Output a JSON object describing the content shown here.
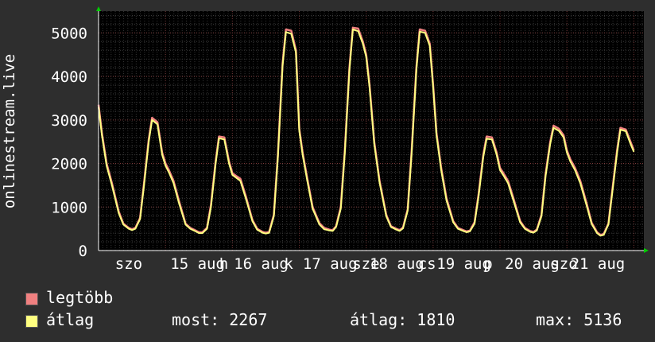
{
  "chart_data": {
    "type": "line",
    "ylabel": "onlinestream.live",
    "ylim": [
      0,
      5500
    ],
    "yticks": [
      0,
      1000,
      2000,
      3000,
      4000,
      5000
    ],
    "x_tick_labels": [
      "szo",
      "15 aug",
      "h",
      "16 aug",
      "k",
      "17 aug",
      "sze",
      "18 aug",
      "cs",
      "19 aug",
      "p",
      "20 aug",
      "szo",
      "21 aug"
    ],
    "grid": true,
    "background": "#000000",
    "series": [
      {
        "name": "legtöbb",
        "color": "#f08080",
        "x": [
          0.0,
          0.05,
          0.12,
          0.2,
          0.3,
          0.37,
          0.45,
          0.5,
          0.55,
          0.62,
          0.68,
          0.75,
          0.8,
          0.88,
          0.95,
          1.0,
          1.05,
          1.12,
          1.2,
          1.3,
          1.37,
          1.45,
          1.5,
          1.55,
          1.62,
          1.68,
          1.75,
          1.8,
          1.88,
          1.95,
          2.0,
          2.05,
          2.12,
          2.2,
          2.3,
          2.37,
          2.45,
          2.5,
          2.55,
          2.62,
          2.68,
          2.75,
          2.8,
          2.88,
          2.95,
          3.0,
          3.05,
          3.12,
          3.2,
          3.3,
          3.37,
          3.45,
          3.5,
          3.55,
          3.62,
          3.68,
          3.75,
          3.8,
          3.88,
          3.95,
          4.0,
          4.05,
          4.12,
          4.2,
          4.3,
          4.37,
          4.45,
          4.5,
          4.55,
          4.62,
          4.68,
          4.75,
          4.8,
          4.88,
          4.95,
          5.0,
          5.05,
          5.12,
          5.2,
          5.3,
          5.37,
          5.45,
          5.5,
          5.55,
          5.62,
          5.68,
          5.75,
          5.8,
          5.88,
          5.95,
          6.0,
          6.05,
          6.12,
          6.2,
          6.3,
          6.37,
          6.45,
          6.5,
          6.55,
          6.62,
          6.68,
          6.75,
          6.8,
          6.88,
          6.95,
          7.0,
          7.05,
          7.12,
          7.2,
          7.3,
          7.37,
          7.45,
          7.5,
          7.55,
          7.62,
          7.68,
          7.75,
          7.8,
          7.88,
          7.95,
          8.0
        ],
        "values": [
          3350,
          2700,
          2000,
          1550,
          900,
          620,
          520,
          490,
          520,
          750,
          1550,
          2550,
          3050,
          2950,
          2250,
          2000,
          1850,
          1600,
          1150,
          620,
          520,
          460,
          420,
          420,
          520,
          1050,
          2050,
          2620,
          2600,
          2050,
          1780,
          1720,
          1650,
          1250,
          700,
          500,
          430,
          410,
          430,
          820,
          2200,
          4300,
          5080,
          5050,
          4600,
          2800,
          2250,
          1650,
          1000,
          630,
          520,
          480,
          470,
          560,
          1000,
          2300,
          4200,
          5120,
          5100,
          4800,
          4500,
          3800,
          2500,
          1600,
          820,
          560,
          500,
          470,
          530,
          950,
          2300,
          4200,
          5080,
          5050,
          4750,
          3800,
          2700,
          1900,
          1200,
          680,
          520,
          470,
          440,
          460,
          650,
          1300,
          2200,
          2620,
          2600,
          2250,
          1900,
          1780,
          1600,
          1200,
          680,
          520,
          450,
          430,
          480,
          820,
          1750,
          2500,
          2870,
          2800,
          2650,
          2300,
          2100,
          1900,
          1600,
          1050,
          640,
          420,
          360,
          380,
          620,
          1400,
          2300,
          2820,
          2780,
          2500,
          2300
        ]
      },
      {
        "name": "átlag",
        "color": "#ffff80",
        "x": [
          0.0,
          0.05,
          0.12,
          0.2,
          0.3,
          0.37,
          0.45,
          0.5,
          0.55,
          0.62,
          0.68,
          0.75,
          0.8,
          0.88,
          0.95,
          1.0,
          1.05,
          1.12,
          1.2,
          1.3,
          1.37,
          1.45,
          1.5,
          1.55,
          1.62,
          1.68,
          1.75,
          1.8,
          1.88,
          1.95,
          2.0,
          2.05,
          2.12,
          2.2,
          2.3,
          2.37,
          2.45,
          2.5,
          2.55,
          2.62,
          2.68,
          2.75,
          2.8,
          2.88,
          2.95,
          3.0,
          3.05,
          3.12,
          3.2,
          3.3,
          3.37,
          3.45,
          3.5,
          3.55,
          3.62,
          3.68,
          3.75,
          3.8,
          3.88,
          3.95,
          4.0,
          4.05,
          4.12,
          4.2,
          4.3,
          4.37,
          4.45,
          4.5,
          4.55,
          4.62,
          4.68,
          4.75,
          4.8,
          4.88,
          4.95,
          5.0,
          5.05,
          5.12,
          5.2,
          5.3,
          5.37,
          5.45,
          5.5,
          5.55,
          5.62,
          5.68,
          5.75,
          5.8,
          5.88,
          5.95,
          6.0,
          6.05,
          6.12,
          6.2,
          6.3,
          6.37,
          6.45,
          6.5,
          6.55,
          6.62,
          6.68,
          6.75,
          6.8,
          6.88,
          6.95,
          7.0,
          7.05,
          7.12,
          7.2,
          7.3,
          7.37,
          7.45,
          7.5,
          7.55,
          7.62,
          7.68,
          7.75,
          7.8,
          7.88,
          7.95,
          8.0
        ],
        "values": [
          3300,
          2650,
          1950,
          1500,
          860,
          600,
          500,
          470,
          500,
          720,
          1500,
          2500,
          3000,
          2900,
          2200,
          1950,
          1800,
          1550,
          1100,
          600,
          500,
          440,
          400,
          400,
          500,
          1000,
          2000,
          2580,
          2550,
          2000,
          1740,
          1680,
          1600,
          1200,
          670,
          480,
          410,
          390,
          410,
          790,
          2150,
          4250,
          5020,
          4980,
          4550,
          2750,
          2200,
          1600,
          960,
          600,
          490,
          460,
          450,
          540,
          960,
          2250,
          4150,
          5080,
          5040,
          4750,
          4450,
          3750,
          2450,
          1560,
          790,
          540,
          480,
          450,
          510,
          920,
          2250,
          4150,
          5030,
          5000,
          4700,
          3750,
          2650,
          1850,
          1150,
          650,
          500,
          450,
          420,
          440,
          620,
          1250,
          2150,
          2570,
          2550,
          2200,
          1850,
          1730,
          1550,
          1150,
          650,
          500,
          430,
          410,
          460,
          790,
          1700,
          2450,
          2820,
          2750,
          2600,
          2250,
          2050,
          1850,
          1550,
          1000,
          610,
          400,
          340,
          360,
          600,
          1350,
          2250,
          2780,
          2740,
          2450,
          2267
        ]
      }
    ],
    "title": ""
  },
  "legend": {
    "items": [
      {
        "label": "legtöbb",
        "color": "#f08080"
      },
      {
        "label": "átlag",
        "color": "#ffff80"
      }
    ],
    "stats": {
      "most": "most: 2267",
      "atlag": "átlag: 1810",
      "max": "max: 5136"
    }
  }
}
